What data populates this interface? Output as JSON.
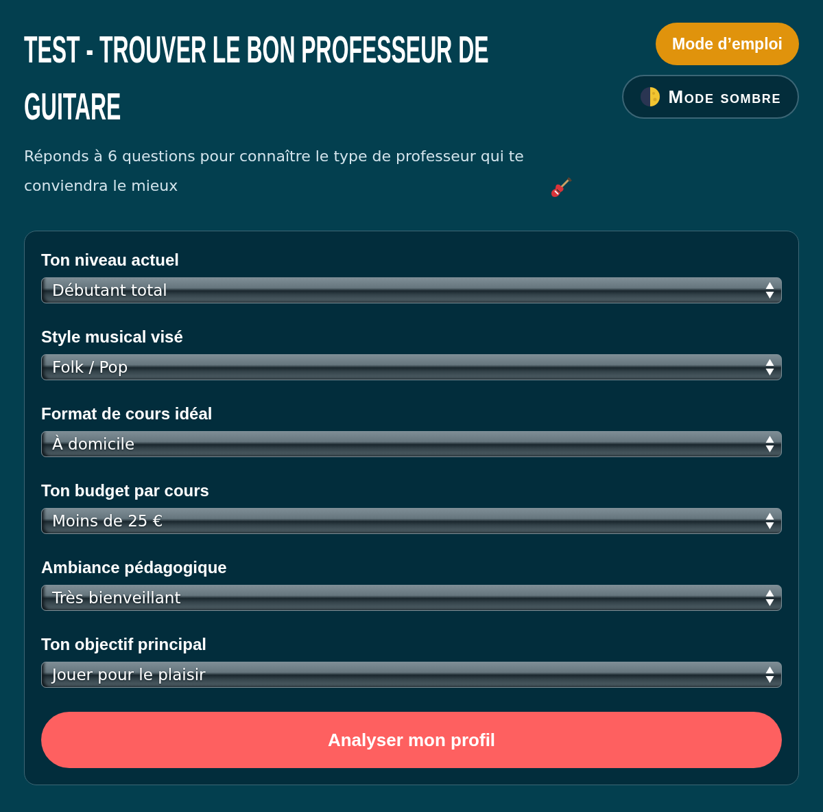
{
  "header": {
    "title": "TEST - TROUVER LE BON PROFESSEUR DE GUITARE",
    "subtitle": "Réponds à 6 questions pour connaître le type de professeur qui te conviendra le mieux"
  },
  "actions": {
    "guide_button": "Mode d’emploi",
    "dark_mode_button": "Mode sombre"
  },
  "form": {
    "fields": [
      {
        "label": "Ton niveau actuel",
        "value": "Débutant total"
      },
      {
        "label": "Style musical visé",
        "value": "Folk / Pop"
      },
      {
        "label": "Format de cours idéal",
        "value": "À domicile"
      },
      {
        "label": "Ton budget par cours",
        "value": "Moins de 25 €"
      },
      {
        "label": "Ambiance pédagogique",
        "value": "Très bienveillant"
      },
      {
        "label": "Ton objectif principal",
        "value": "Jouer pour le plaisir"
      }
    ],
    "submit_button": "Analyser mon profil"
  }
}
